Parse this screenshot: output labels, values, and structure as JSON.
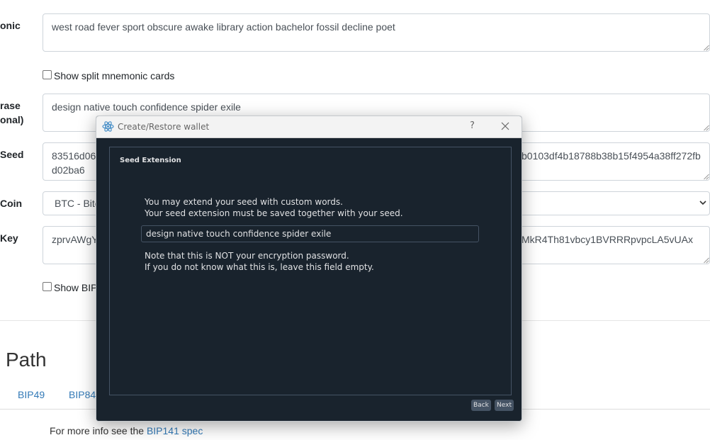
{
  "form": {
    "mnemonic_label": "onic",
    "mnemonic_value": "west road fever sport obscure awake library action bachelor fossil decline poet",
    "split_cards_label": "Show split mnemonic cards",
    "passphrase_label_1": "rase",
    "passphrase_label_2": "onal)",
    "passphrase_value": "design native touch confidence spider exile",
    "seed_label": "Seed",
    "seed_value_left": "83516d06",
    "seed_value_right": "b0103df4b18788b38b15f4954a38ff272fb",
    "seed_value_line2": "d02ba6",
    "coin_label": "Coin",
    "coin_value": "BTC - Bitc",
    "key_label": "Key",
    "key_value_left": "zprvAWgY",
    "key_value_right": "MkR4Th81vbcy1BVRRRpvpcLA5vUAx",
    "bip_checkbox_label": "Show BIP"
  },
  "derivation": {
    "heading": "Path",
    "tabs": [
      "BIP49",
      "BIP84"
    ],
    "more_info_prefix": "For more info see the",
    "more_info_link": "BIP141 spec"
  },
  "dialog": {
    "title": "Create/Restore wallet",
    "help_glyph": "?",
    "section_title": "Seed Extension",
    "intro_line1": "You may extend your seed with custom words.",
    "intro_line2": "Your seed extension must be saved together with your seed.",
    "extension_value": "design native touch confidence spider exile",
    "note_line1": "Note that this is NOT your encryption password.",
    "note_line2": "If you do not know what this is, leave this field empty.",
    "back_label": "Back",
    "next_label": "Next"
  }
}
